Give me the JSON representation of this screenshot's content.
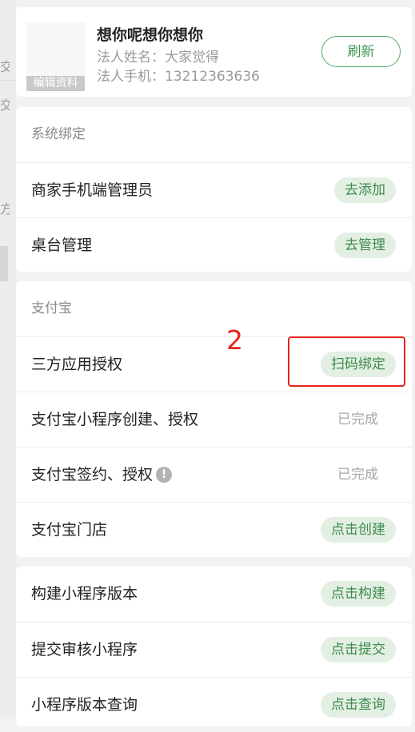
{
  "profile": {
    "name": "想你呢想你想你",
    "legal_name": "法人姓名：大家觉得",
    "legal_phone": "法人手机：13212363636",
    "edit_label": "编辑资料",
    "refresh_label": "刷新"
  },
  "system_binding": {
    "title": "系统绑定",
    "rows": [
      {
        "label": "商家手机端管理员",
        "action": "去添加"
      },
      {
        "label": "桌台管理",
        "action": "去管理"
      }
    ]
  },
  "alipay": {
    "title": "支付宝",
    "rows": [
      {
        "label": "三方应用授权",
        "action": "扫码绑定"
      },
      {
        "label": "支付宝小程序创建、授权",
        "status": "已完成"
      },
      {
        "label": "支付宝签约、授权",
        "status": "已完成",
        "icon": "info-icon"
      },
      {
        "label": "支付宝门店",
        "action": "点击创建"
      }
    ]
  },
  "mini_program": {
    "rows": [
      {
        "label": "构建小程序版本",
        "action": "点击构建"
      },
      {
        "label": "提交审核小程序",
        "action": "点击提交"
      },
      {
        "label": "小程序版本查询",
        "action": "点击查询"
      }
    ]
  },
  "annotation": {
    "number": "2",
    "color": "#e8221b"
  },
  "colors": {
    "accent_green": "#3d8a4c",
    "pill_bg": "#e3efe3",
    "page_bg": "#f2f2f2"
  }
}
